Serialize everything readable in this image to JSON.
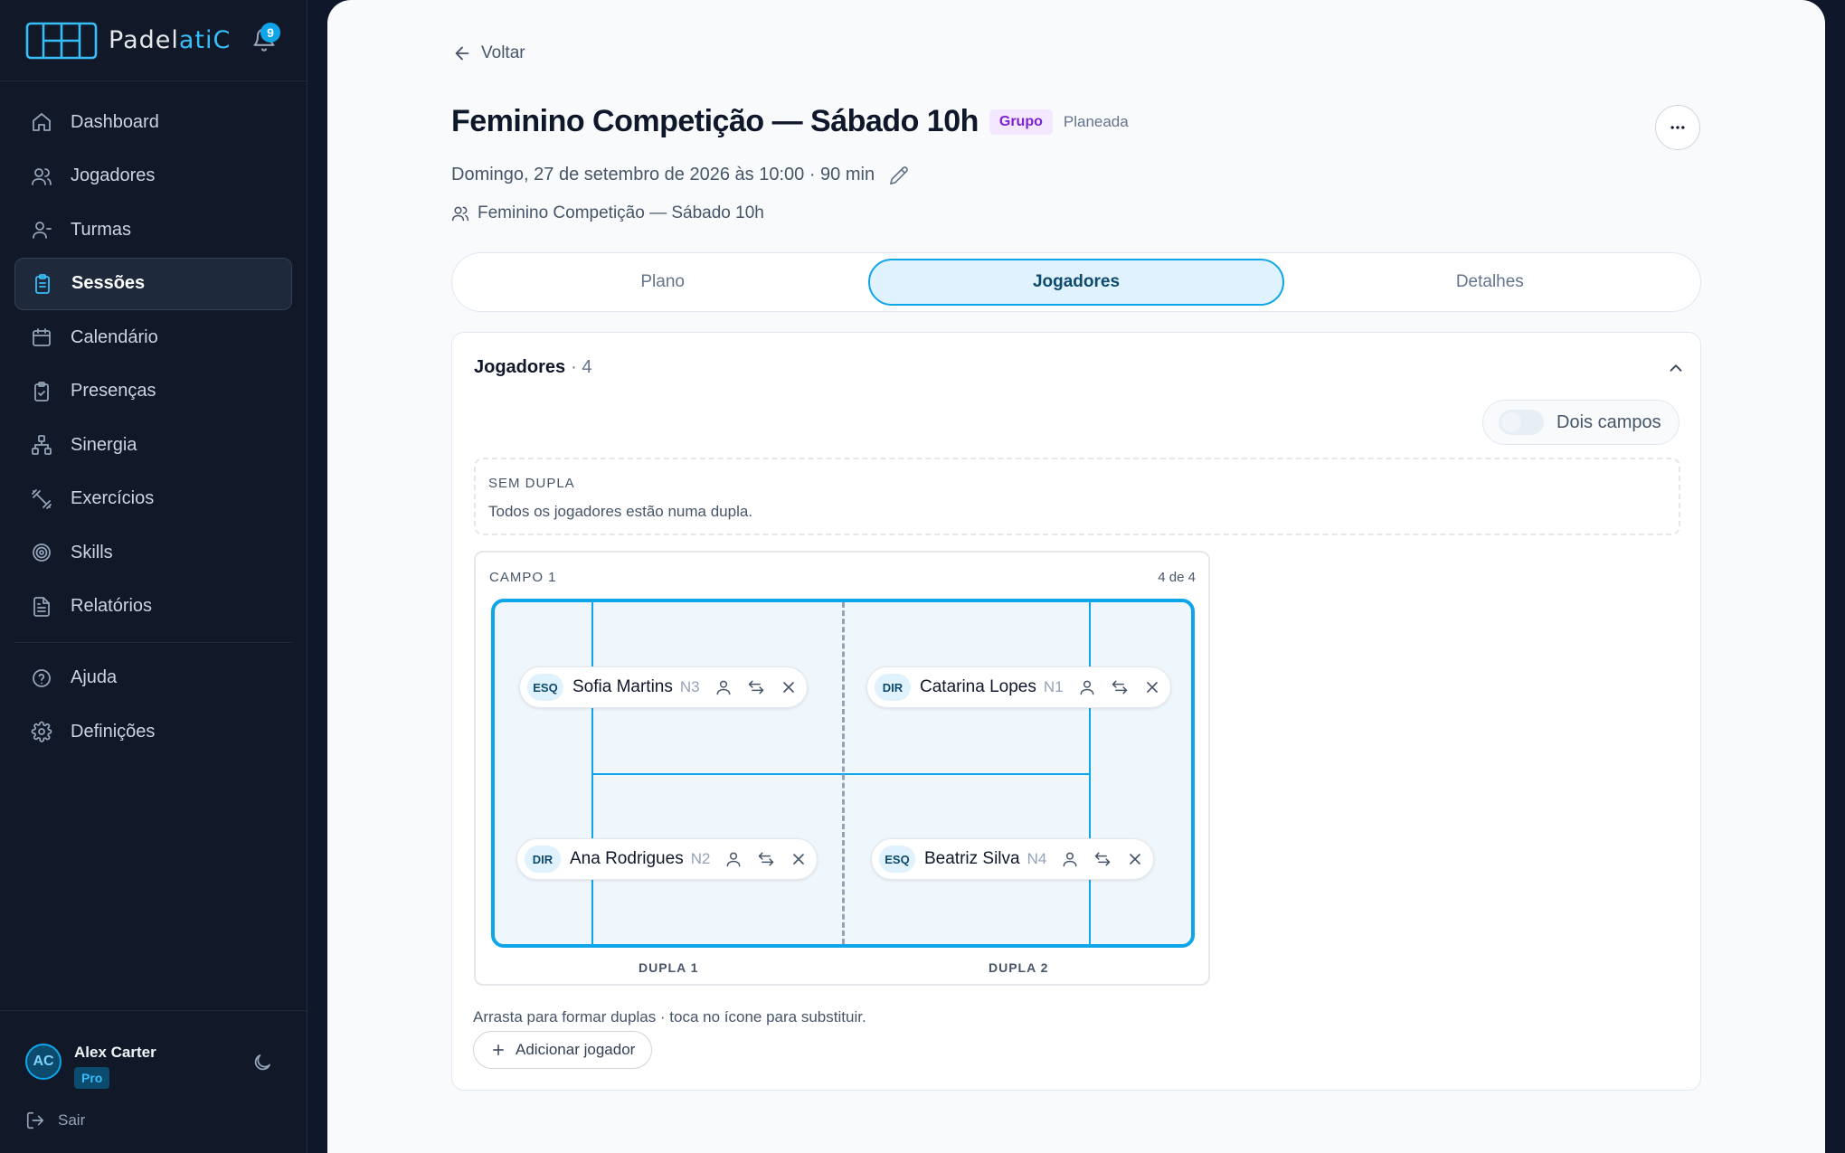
{
  "app": {
    "brand_prefix": "Padel",
    "brand_suffix": "atiC",
    "notifications_count": "9"
  },
  "sidebar": {
    "items": [
      {
        "label": "Dashboard",
        "icon": "home-icon"
      },
      {
        "label": "Jogadores",
        "icon": "users-icon"
      },
      {
        "label": "Turmas",
        "icon": "user-group-icon"
      },
      {
        "label": "Sessões",
        "icon": "clipboard-icon",
        "active": true
      },
      {
        "label": "Calendário",
        "icon": "calendar-icon"
      },
      {
        "label": "Presenças",
        "icon": "clipboard-check-icon"
      },
      {
        "label": "Sinergia",
        "icon": "network-icon"
      },
      {
        "label": "Exercícios",
        "icon": "dumbbell-icon"
      },
      {
        "label": "Skills",
        "icon": "target-icon"
      },
      {
        "label": "Relatórios",
        "icon": "document-icon"
      }
    ],
    "secondary": [
      {
        "label": "Ajuda",
        "icon": "help-circle-icon"
      },
      {
        "label": "Definições",
        "icon": "gear-icon"
      }
    ],
    "user": {
      "initials": "AC",
      "name": "Alex Carter",
      "plan": "Pro"
    },
    "logout_label": "Sair"
  },
  "page": {
    "back_label": "Voltar",
    "title": "Feminino Competição — Sábado 10h",
    "type_tag": "Grupo",
    "status": "Planeada",
    "schedule": "Domingo, 27 de setembro de 2026 às 10:00 · 90 min",
    "group": "Feminino Competição — Sábado 10h"
  },
  "tabs": [
    {
      "label": "Plano",
      "active": false
    },
    {
      "label": "Jogadores",
      "active": true
    },
    {
      "label": "Detalhes",
      "active": false
    }
  ],
  "players_card": {
    "title": "Jogadores",
    "count": "· 4",
    "toggle_label": "Dois campos",
    "toggle_on": false,
    "unpaired": {
      "title": "SEM DUPLA",
      "text": "Todos os jogadores estão numa dupla."
    },
    "court": {
      "title": "CAMPO 1",
      "count": "4 de 4",
      "players": [
        {
          "side": "ESQ",
          "name": "Sofia Martins",
          "level": "N3"
        },
        {
          "side": "DIR",
          "name": "Catarina Lopes",
          "level": "N1"
        },
        {
          "side": "DIR",
          "name": "Ana Rodrigues",
          "level": "N2"
        },
        {
          "side": "ESQ",
          "name": "Beatriz Silva",
          "level": "N4"
        }
      ],
      "pair_labels": [
        "DUPLA 1",
        "DUPLA 2"
      ]
    },
    "hint": "Arrasta para formar duplas · toca no ícone para substituir.",
    "add_label": "Adicionar jogador"
  },
  "colors": {
    "accent": "#0ea5e9",
    "sidebar_bg": "#111827",
    "tag_purple": "#7e22ce",
    "court_bg": "#eff7fd"
  }
}
